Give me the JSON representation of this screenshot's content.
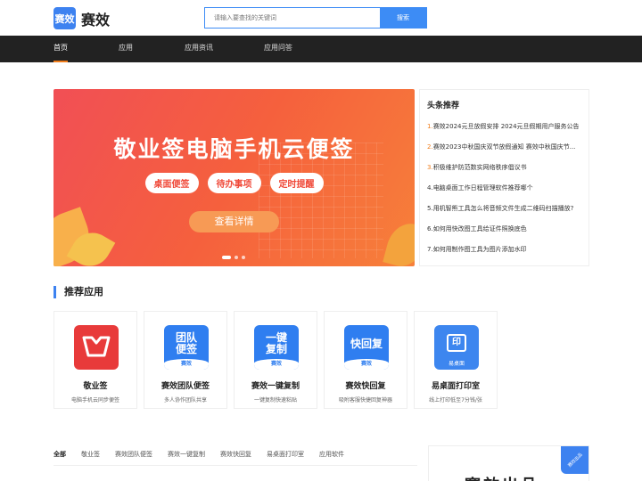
{
  "header": {
    "logo_mark": "赛效",
    "logo_text": "赛效",
    "search_placeholder": "请输入要查找的关键词",
    "search_button": "搜索"
  },
  "nav": {
    "items": [
      {
        "label": "首页",
        "active": true
      },
      {
        "label": "应用",
        "active": false
      },
      {
        "label": "应用资讯",
        "active": false
      },
      {
        "label": "应用问答",
        "active": false
      }
    ]
  },
  "banner": {
    "title": "敬业签电脑手机云便签",
    "tags": [
      "桌面便签",
      "待办事项",
      "定时提醒"
    ],
    "button": "查看详情",
    "slides": 3,
    "active_slide": 1
  },
  "headlines": {
    "title": "头条推荐",
    "items": [
      {
        "num": "1.",
        "text": "赛效2024元旦放假安排 2024元旦假期用户服务公告"
      },
      {
        "num": "2.",
        "text": "赛效2023中秋国庆双节放假通知 赛效中秋国庆节..."
      },
      {
        "num": "3.",
        "text": "积极维护防范数实网络秩序倡议书"
      },
      {
        "num": "4.",
        "text": "电脑桌面工作日程管理软件推荐哪个"
      },
      {
        "num": "5.",
        "text": "用机智熊工具怎么将音频文件生成二维码扫描播放?"
      },
      {
        "num": "6.",
        "text": "如何用快改图工具给证件照换底色"
      },
      {
        "num": "7.",
        "text": "如何用制作图工具为图片添加水印"
      }
    ]
  },
  "recommended": {
    "title": "推荐应用",
    "apps": [
      {
        "name": "敬业签",
        "desc": "电脑手机云同步便签",
        "icon": "jingyeqian-icon"
      },
      {
        "name": "赛效团队便签",
        "desc": "多人协作团队共享",
        "icon": "team-note-icon",
        "icon_text": [
          "团队",
          "便签"
        ],
        "band": "赛效"
      },
      {
        "name": "赛效一键复制",
        "desc": "一键复制快速粘贴",
        "icon": "one-click-copy-icon",
        "icon_text": [
          "一键",
          "复制"
        ],
        "band": "赛效"
      },
      {
        "name": "赛效快回复",
        "desc": "吸附客服快捷回复神器",
        "icon": "quick-reply-icon",
        "icon_text": [
          "快回复"
        ],
        "band": "赛效"
      },
      {
        "name": "易桌面打印室",
        "desc": "线上打印低至7分钱/张",
        "icon": "print-room-icon",
        "icon_text": [
          "印"
        ],
        "band": "易桌面"
      }
    ]
  },
  "tabs": {
    "items": [
      {
        "label": "全部",
        "active": true
      },
      {
        "label": "敬业签",
        "active": false
      },
      {
        "label": "赛效团队便签",
        "active": false
      },
      {
        "label": "赛效一键复制",
        "active": false
      },
      {
        "label": "赛效快回复",
        "active": false
      },
      {
        "label": "易桌面打印室",
        "active": false
      },
      {
        "label": "应用软件",
        "active": false
      }
    ]
  },
  "promo": {
    "badge": "赛效出品",
    "title": "赛效出品"
  },
  "colors": {
    "brand": "#3d82f0",
    "accent": "#f07c1a",
    "nav_bg": "#222222",
    "banner_start": "#f14f55",
    "banner_end": "#f7803a"
  }
}
